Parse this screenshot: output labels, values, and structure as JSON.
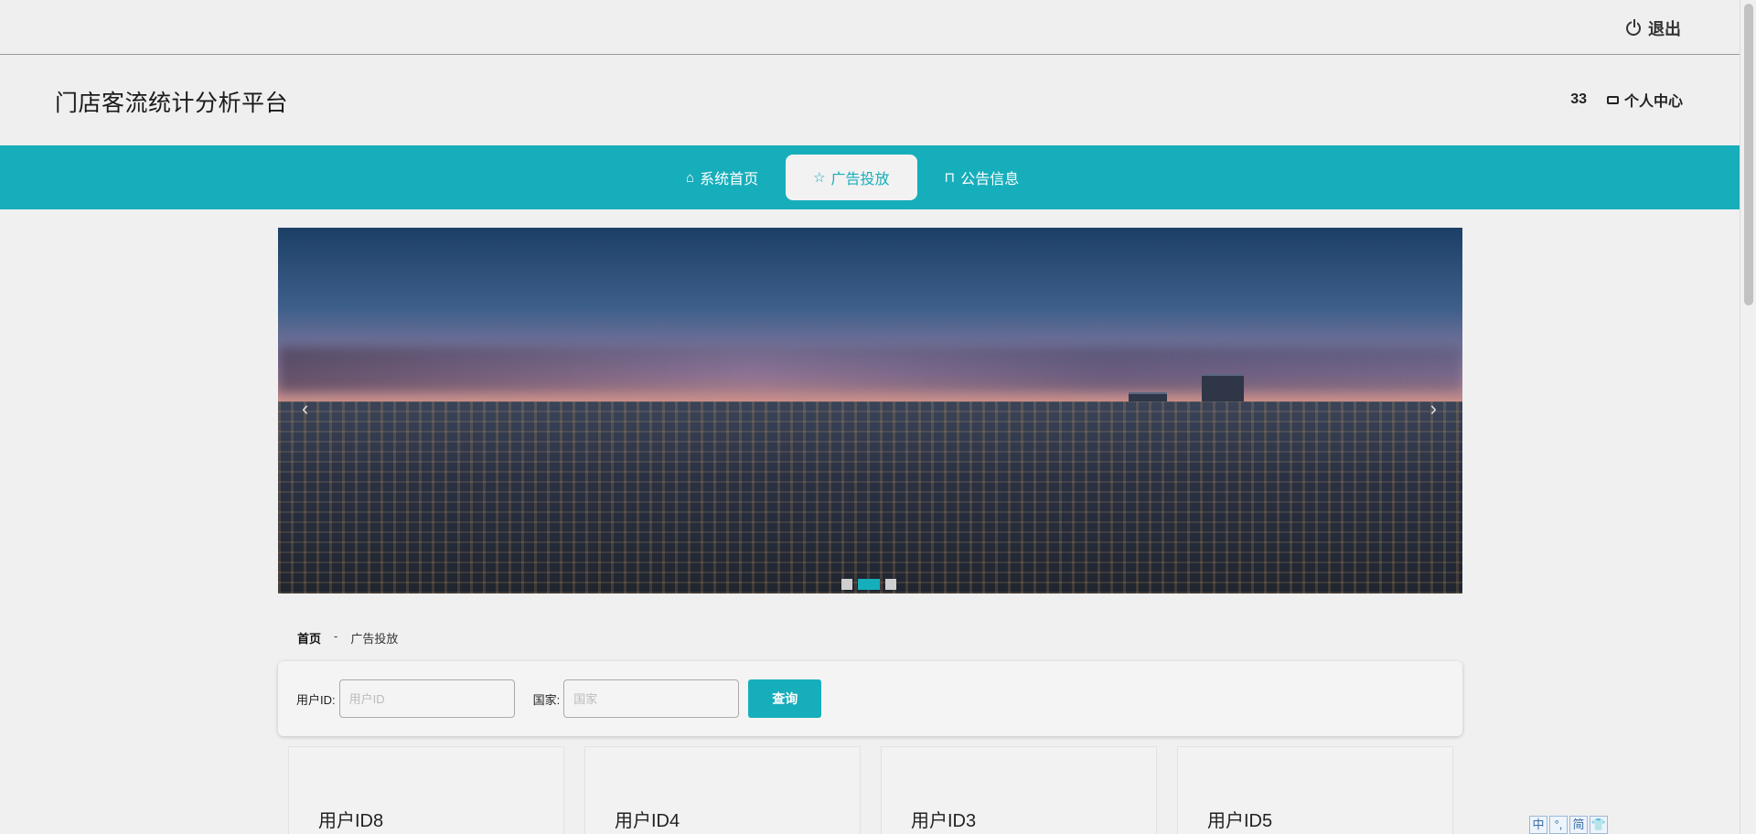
{
  "topbar": {
    "logout_label": "退出"
  },
  "header": {
    "site_title": "门店客流统计分析平台",
    "user_id": "33",
    "personal_center": "个人中心"
  },
  "nav": {
    "items": [
      {
        "label": "系统首页",
        "icon": "home-icon",
        "active": false
      },
      {
        "label": "广告投放",
        "icon": "star-icon",
        "active": true
      },
      {
        "label": "公告信息",
        "icon": "bag-icon",
        "active": false
      }
    ]
  },
  "banner": {
    "prev": "‹",
    "next": "›",
    "active_slide": 2,
    "slide_count": 3
  },
  "breadcrumb": {
    "home": "首页",
    "separator": "-",
    "current": "广告投放"
  },
  "search": {
    "user_id_label": "用户ID:",
    "user_id_placeholder": "用户ID",
    "country_label": "国家:",
    "country_placeholder": "国家",
    "query_button": "查询"
  },
  "cards": [
    {
      "title": "用户ID8"
    },
    {
      "title": "用户ID4"
    },
    {
      "title": "用户ID3"
    },
    {
      "title": "用户ID5"
    }
  ],
  "ime": [
    "中",
    "°,",
    "简",
    "👕"
  ],
  "colors": {
    "accent": "#17aebb",
    "background": "#f0f0f0"
  }
}
